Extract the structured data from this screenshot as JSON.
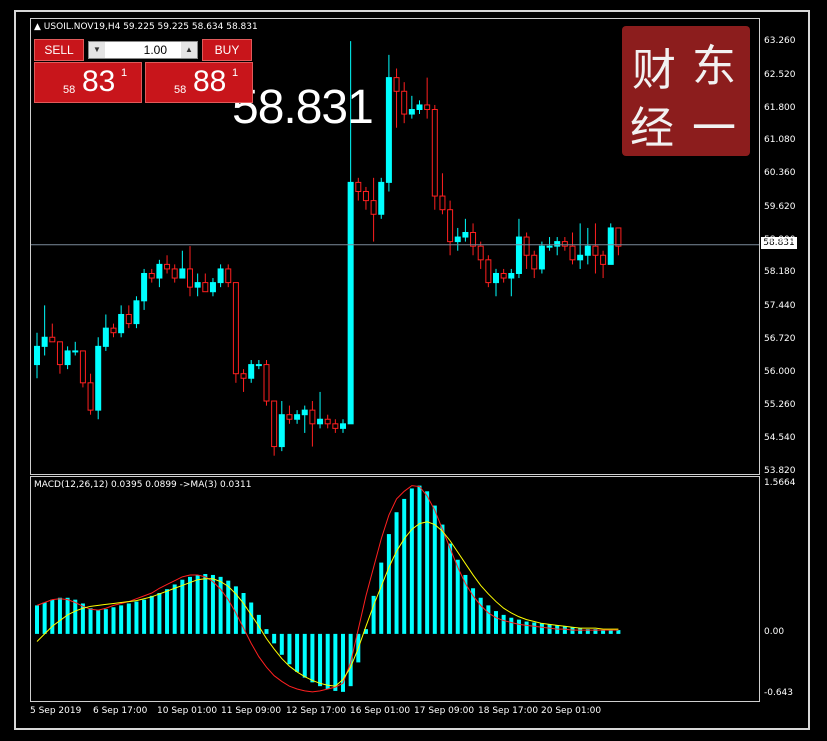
{
  "header": {
    "symbol_line": "USOIL.NOV19,H4  59.225 59.225 58.634 58.831",
    "big_price": "58.831"
  },
  "one_click": {
    "sell_label": "SELL",
    "buy_label": "BUY",
    "lot": "1.00",
    "sell_prefix": "58",
    "sell_big": "83",
    "sell_sup": "1",
    "buy_prefix": "58",
    "buy_big": "88",
    "buy_sup": "1"
  },
  "logo": {
    "chars": [
      "财",
      "东",
      "经",
      "一"
    ]
  },
  "price_axis": [
    "63.260",
    "62.520",
    "61.800",
    "61.080",
    "60.360",
    "59.620",
    "58.900",
    "58.180",
    "57.440",
    "56.720",
    "56.000",
    "55.260",
    "54.540",
    "53.820"
  ],
  "current_price_tag": "58.831",
  "macd": {
    "label": "MACD(12,26,12) 0.0395 0.0899  ->MA(3) 0.0311",
    "axis": [
      "1.5664",
      "0.00",
      "-0.643"
    ]
  },
  "time_axis": [
    "5 Sep 2019",
    "6 Sep 17:00",
    "10 Sep 01:00",
    "11 Sep 09:00",
    "12 Sep 17:00",
    "16 Sep 01:00",
    "17 Sep 09:00",
    "18 Sep 17:00",
    "20 Sep 01:00"
  ],
  "colors": {
    "bull": "#00ffff",
    "bear": "#ff2020",
    "signal": "#ffff00",
    "macd_line": "#ff2020",
    "sell": "#c8151b",
    "logo": "#8c1d1d"
  },
  "chart_data": {
    "type": "candlestick",
    "ylim": [
      53.82,
      63.26
    ],
    "candles": [
      [
        56.2,
        56.9,
        55.9,
        56.6
      ],
      [
        56.6,
        57.5,
        56.4,
        56.8
      ],
      [
        56.8,
        57.1,
        56.7,
        56.7
      ],
      [
        56.7,
        56.7,
        56.0,
        56.2
      ],
      [
        56.2,
        56.6,
        56.1,
        56.5
      ],
      [
        56.5,
        56.7,
        56.4,
        56.5
      ],
      [
        56.5,
        56.5,
        55.7,
        55.8
      ],
      [
        55.8,
        56.0,
        55.1,
        55.2
      ],
      [
        55.2,
        56.8,
        55.0,
        56.6
      ],
      [
        56.6,
        57.3,
        56.5,
        57.0
      ],
      [
        57.0,
        57.1,
        56.8,
        56.9
      ],
      [
        56.9,
        57.5,
        56.8,
        57.3
      ],
      [
        57.3,
        57.5,
        57.0,
        57.1
      ],
      [
        57.1,
        57.7,
        57.0,
        57.6
      ],
      [
        57.6,
        58.3,
        57.4,
        58.2
      ],
      [
        58.2,
        58.3,
        58.0,
        58.1
      ],
      [
        58.1,
        58.5,
        57.9,
        58.4
      ],
      [
        58.4,
        58.6,
        58.2,
        58.3
      ],
      [
        58.3,
        58.4,
        58.0,
        58.1
      ],
      [
        58.1,
        58.7,
        58.1,
        58.3
      ],
      [
        58.3,
        58.8,
        57.7,
        57.9
      ],
      [
        57.9,
        58.2,
        57.7,
        58.0
      ],
      [
        58.0,
        58.2,
        57.8,
        57.8
      ],
      [
        57.8,
        58.1,
        57.7,
        58.0
      ],
      [
        58.0,
        58.4,
        57.9,
        58.3
      ],
      [
        58.3,
        58.4,
        57.9,
        58.0
      ],
      [
        58.0,
        58.0,
        55.8,
        56.0
      ],
      [
        56.0,
        56.1,
        55.6,
        55.9
      ],
      [
        55.9,
        56.3,
        55.8,
        56.2
      ],
      [
        56.2,
        56.3,
        56.1,
        56.2
      ],
      [
        56.2,
        56.3,
        55.3,
        55.4
      ],
      [
        55.4,
        55.4,
        54.2,
        54.4
      ],
      [
        54.4,
        55.4,
        54.3,
        55.1
      ],
      [
        55.1,
        55.3,
        54.9,
        55.0
      ],
      [
        55.0,
        55.2,
        54.9,
        55.1
      ],
      [
        55.1,
        55.3,
        54.7,
        55.2
      ],
      [
        55.2,
        55.4,
        54.4,
        54.9
      ],
      [
        54.9,
        55.6,
        54.8,
        55.0
      ],
      [
        55.0,
        55.1,
        54.8,
        54.9
      ],
      [
        54.9,
        55.0,
        54.7,
        54.8
      ],
      [
        54.8,
        55.0,
        54.7,
        54.9
      ],
      [
        54.9,
        63.3,
        59.6,
        60.2
      ],
      [
        60.2,
        60.3,
        59.8,
        60.0
      ],
      [
        60.0,
        60.1,
        59.6,
        59.8
      ],
      [
        59.8,
        60.3,
        58.9,
        59.5
      ],
      [
        59.5,
        60.3,
        59.4,
        60.2
      ],
      [
        60.2,
        63.0,
        60.0,
        62.5
      ],
      [
        62.5,
        62.7,
        61.4,
        62.2
      ],
      [
        62.2,
        62.4,
        61.5,
        61.7
      ],
      [
        61.7,
        62.1,
        61.6,
        61.8
      ],
      [
        61.8,
        62.0,
        61.7,
        61.9
      ],
      [
        61.9,
        62.5,
        61.6,
        61.8
      ],
      [
        61.8,
        61.9,
        59.6,
        59.9
      ],
      [
        59.9,
        60.4,
        59.5,
        59.6
      ],
      [
        59.6,
        59.8,
        58.6,
        58.9
      ],
      [
        58.9,
        59.2,
        58.7,
        59.0
      ],
      [
        59.0,
        59.4,
        58.9,
        59.1
      ],
      [
        59.1,
        59.3,
        58.6,
        58.8
      ],
      [
        58.8,
        58.9,
        58.3,
        58.5
      ],
      [
        58.5,
        58.6,
        57.9,
        58.0
      ],
      [
        58.0,
        58.3,
        57.7,
        58.2
      ],
      [
        58.2,
        58.3,
        58.0,
        58.1
      ],
      [
        58.1,
        58.3,
        57.7,
        58.2
      ],
      [
        58.2,
        59.4,
        58.1,
        59.0
      ],
      [
        59.0,
        59.1,
        58.3,
        58.6
      ],
      [
        58.6,
        58.7,
        58.1,
        58.3
      ],
      [
        58.3,
        58.9,
        58.2,
        58.8
      ],
      [
        58.8,
        59.0,
        58.7,
        58.8
      ],
      [
        58.8,
        59.0,
        58.6,
        58.9
      ],
      [
        58.9,
        59.0,
        58.7,
        58.8
      ],
      [
        58.8,
        59.1,
        58.4,
        58.5
      ],
      [
        58.5,
        59.3,
        58.3,
        58.6
      ],
      [
        58.6,
        59.2,
        58.4,
        58.8
      ],
      [
        58.8,
        59.3,
        58.2,
        58.6
      ],
      [
        58.6,
        58.7,
        58.1,
        58.4
      ],
      [
        58.4,
        59.3,
        58.6,
        59.2
      ],
      [
        59.2,
        59.2,
        58.6,
        58.8
      ]
    ],
    "macd_values": [
      0.3,
      0.33,
      0.36,
      0.38,
      0.38,
      0.36,
      0.32,
      0.27,
      0.25,
      0.26,
      0.28,
      0.3,
      0.32,
      0.34,
      0.36,
      0.4,
      0.43,
      0.47,
      0.52,
      0.57,
      0.6,
      0.62,
      0.63,
      0.62,
      0.6,
      0.56,
      0.5,
      0.43,
      0.33,
      0.2,
      0.05,
      -0.1,
      -0.22,
      -0.32,
      -0.4,
      -0.46,
      -0.51,
      -0.55,
      -0.58,
      -0.6,
      -0.61,
      -0.55,
      -0.3,
      0.05,
      0.4,
      0.75,
      1.05,
      1.28,
      1.42,
      1.53,
      1.56,
      1.5,
      1.35,
      1.15,
      0.95,
      0.78,
      0.62,
      0.48,
      0.38,
      0.3,
      0.24,
      0.2,
      0.17,
      0.15,
      0.13,
      0.12,
      0.11,
      0.1,
      0.09,
      0.08,
      0.07,
      0.06,
      0.05,
      0.05,
      0.04,
      0.04,
      0.04
    ],
    "macd_line": [
      0.3,
      0.33,
      0.36,
      0.37,
      0.36,
      0.33,
      0.29,
      0.26,
      0.25,
      0.27,
      0.3,
      0.32,
      0.34,
      0.37,
      0.4,
      0.43,
      0.48,
      0.52,
      0.56,
      0.6,
      0.62,
      0.62,
      0.6,
      0.55,
      0.47,
      0.36,
      0.22,
      0.06,
      -0.1,
      -0.24,
      -0.35,
      -0.44,
      -0.5,
      -0.55,
      -0.58,
      -0.6,
      -0.61,
      -0.6,
      -0.58,
      -0.56,
      -0.52,
      -0.3,
      0.05,
      0.4,
      0.7,
      1.0,
      1.25,
      1.42,
      1.5,
      1.56,
      1.55,
      1.45,
      1.3,
      1.1,
      0.9,
      0.7,
      0.53,
      0.4,
      0.3,
      0.22,
      0.17,
      0.14,
      0.12,
      0.1,
      0.09,
      0.08,
      0.07,
      0.06,
      0.05,
      0.05,
      0.04,
      0.04,
      0.04,
      0.04,
      0.04,
      0.04,
      0.04
    ],
    "signal_line": [
      -0.08,
      0.0,
      0.08,
      0.14,
      0.2,
      0.24,
      0.27,
      0.29,
      0.3,
      0.31,
      0.32,
      0.33,
      0.34,
      0.35,
      0.37,
      0.39,
      0.42,
      0.45,
      0.48,
      0.51,
      0.54,
      0.57,
      0.58,
      0.58,
      0.55,
      0.5,
      0.42,
      0.32,
      0.2,
      0.08,
      -0.05,
      -0.16,
      -0.26,
      -0.34,
      -0.4,
      -0.45,
      -0.49,
      -0.52,
      -0.54,
      -0.55,
      -0.48,
      -0.35,
      -0.15,
      0.08,
      0.3,
      0.5,
      0.7,
      0.87,
      1.0,
      1.1,
      1.16,
      1.18,
      1.15,
      1.08,
      0.98,
      0.86,
      0.74,
      0.62,
      0.51,
      0.42,
      0.34,
      0.27,
      0.22,
      0.18,
      0.15,
      0.13,
      0.11,
      0.1,
      0.09,
      0.08,
      0.07,
      0.06,
      0.06,
      0.06,
      0.05,
      0.05,
      0.05
    ],
    "macd_ylim": [
      -0.643,
      1.5664
    ]
  }
}
